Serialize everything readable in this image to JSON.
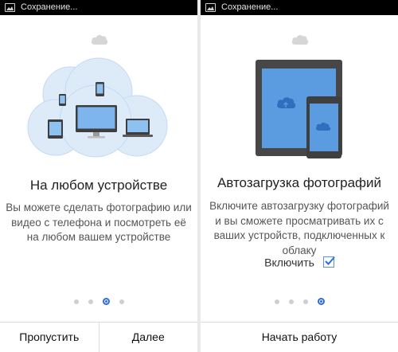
{
  "left_screen": {
    "status_text": "Сохранение...",
    "title": "На любом устройстве",
    "description": "Вы можете сделать фотографию или видео с телефона и посмотреть её на любом вашем устройстве",
    "page_indicator": {
      "total": 4,
      "current": 3
    },
    "skip_label": "Пропустить",
    "next_label": "Далее"
  },
  "right_screen": {
    "status_text": "Сохранение...",
    "title": "Автозагрузка фотографий",
    "description": "Включите автозагрузку фотографий и вы сможете просматривать их с ваших устройств, подключенных к облаку",
    "enable_label": "Включить",
    "enable_checked": true,
    "page_indicator": {
      "total": 4,
      "current": 4
    },
    "start_label": "Начать работу"
  },
  "icons": {
    "status": "image-icon",
    "small_cloud": "cloud-icon",
    "device_cloud": "cloud-upload-icon"
  },
  "colors": {
    "accent": "#2d6be5",
    "circle_fill": "#ddebf9",
    "screen_blue": "#5b9be0",
    "device_dark": "#4a4a4a"
  }
}
